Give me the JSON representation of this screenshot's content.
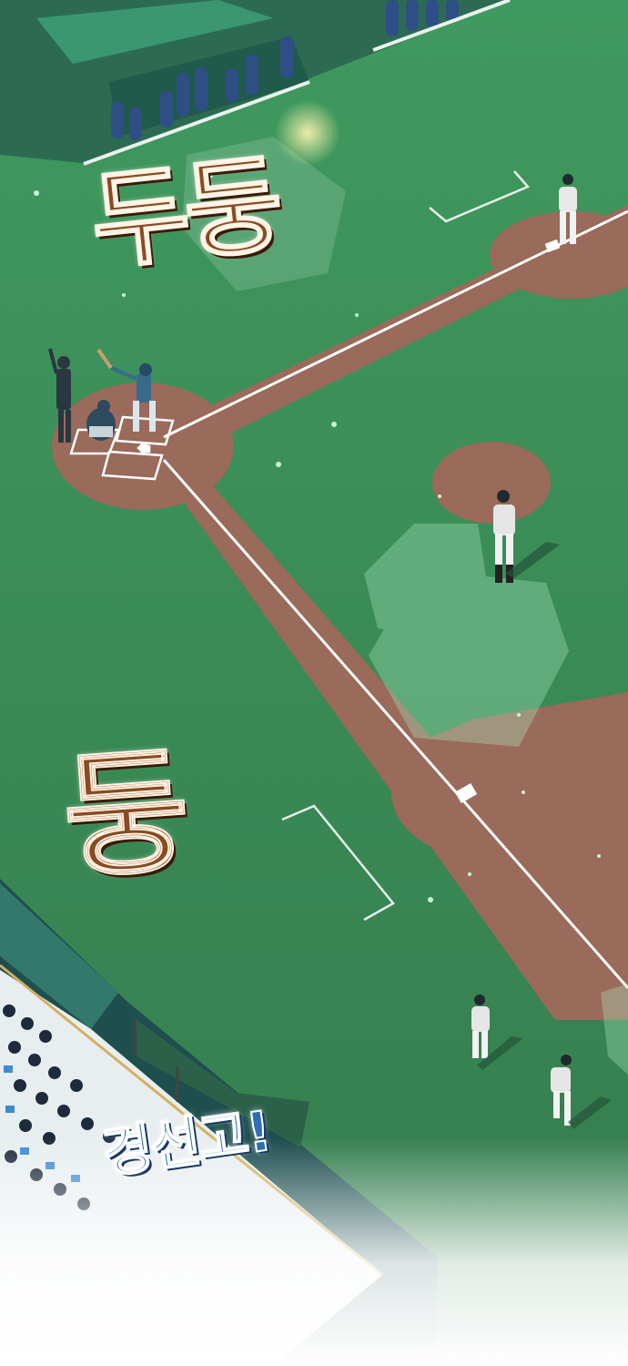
{
  "panel": {
    "sound_effects": {
      "top": "두둥",
      "middle": "둥"
    },
    "shout": "경선고!"
  },
  "colors": {
    "grass": "#3d8f5a",
    "dirt": "#9a6a5a",
    "sfx_brown": "#8a4a22",
    "shout_blue": "#2f6fb0",
    "stands": "#1d4f5e"
  }
}
